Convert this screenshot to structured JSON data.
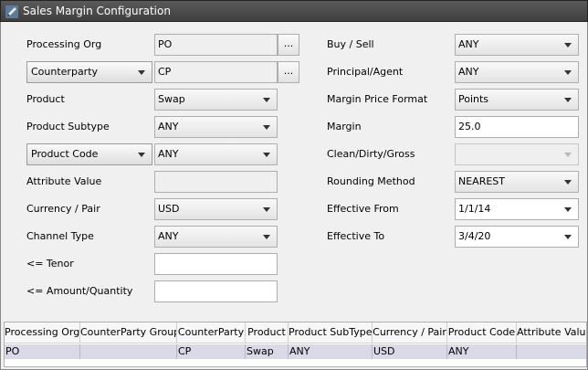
{
  "window": {
    "title": "Sales Margin Configuration"
  },
  "left": {
    "processing_org": {
      "label": "Processing Org",
      "value": "PO",
      "button": "..."
    },
    "counterparty": {
      "selector": "Counterparty",
      "value": "CP",
      "button": "..."
    },
    "product": {
      "label": "Product",
      "value": "Swap"
    },
    "product_subtype": {
      "label": "Product Subtype",
      "value": "ANY"
    },
    "product_code": {
      "selector": "Product Code",
      "value": "ANY"
    },
    "attribute_value": {
      "label": "Attribute Value",
      "value": ""
    },
    "currency_pair": {
      "label": "Currency / Pair",
      "value": "USD"
    },
    "channel_type": {
      "label": "Channel Type",
      "value": "ANY"
    },
    "tenor": {
      "label": "<= Tenor",
      "value": ""
    },
    "amount": {
      "label": "<= Amount/Quantity",
      "value": ""
    }
  },
  "right": {
    "buy_sell": {
      "label": "Buy / Sell",
      "value": "ANY"
    },
    "principal_agent": {
      "label": "Principal/Agent",
      "value": "ANY"
    },
    "margin_price_format": {
      "label": "Margin Price Format",
      "value": "Points"
    },
    "margin": {
      "label": "Margin",
      "value": "25.0"
    },
    "clean_dirty_gross": {
      "label": "Clean/Dirty/Gross",
      "value": ""
    },
    "rounding_method": {
      "label": "Rounding Method",
      "value": "NEAREST"
    },
    "effective_from": {
      "label": "Effective From",
      "value": "1/1/14"
    },
    "effective_to": {
      "label": "Effective To",
      "value": "3/4/20"
    }
  },
  "table": {
    "columns": [
      "Processing Org",
      "CounterParty Group",
      "CounterParty",
      "Product",
      "Product SubType",
      "Currency / Pair",
      "Product Code",
      "Attribute Value"
    ],
    "rows": [
      [
        "PO",
        "",
        "CP",
        "Swap",
        "ANY",
        "USD",
        "ANY",
        ""
      ]
    ]
  }
}
